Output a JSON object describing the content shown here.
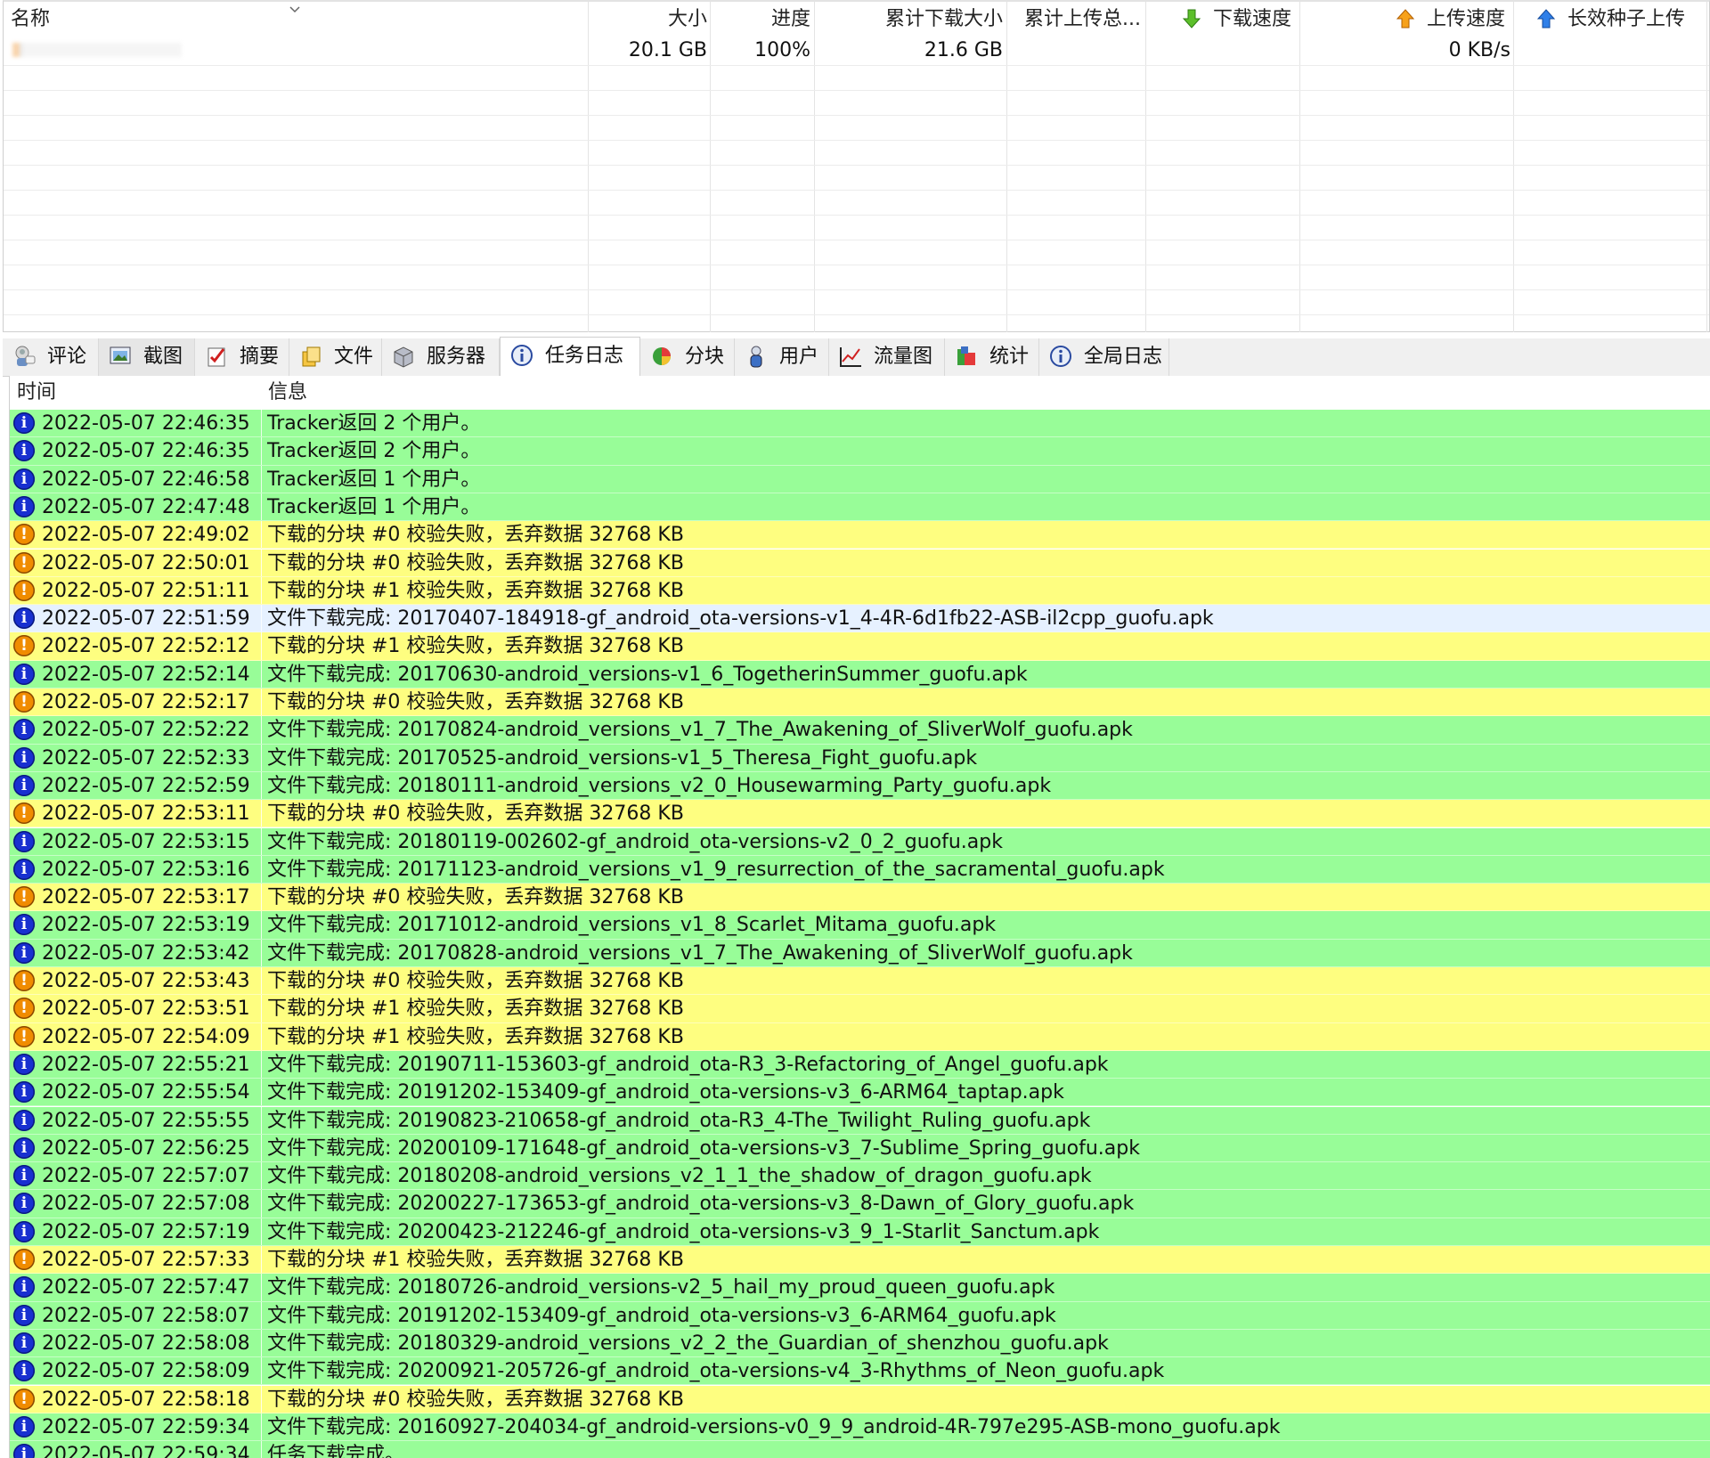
{
  "task_list": {
    "columns": {
      "name": "名称",
      "size": "大小",
      "progress": "进度",
      "downloaded_total": "累计下载大小",
      "uploaded_total": "累计上传总...",
      "download_speed": "下载速度",
      "upload_speed": "上传速度",
      "seed_upload": "长效种子上传"
    },
    "row": {
      "size": "20.1 GB",
      "progress": "100%",
      "downloaded_total": "21.6 GB",
      "upload_speed": "0 KB/s"
    }
  },
  "tabs": [
    {
      "label": "评论",
      "icon": "comment-icon"
    },
    {
      "label": "截图",
      "icon": "screenshot-icon"
    },
    {
      "label": "摘要",
      "icon": "summary-icon"
    },
    {
      "label": "文件",
      "icon": "files-icon"
    },
    {
      "label": "服务器",
      "icon": "server-icon"
    },
    {
      "label": "任务日志",
      "icon": "info-icon",
      "active": true
    },
    {
      "label": "分块",
      "icon": "pie-chart-icon"
    },
    {
      "label": "用户",
      "icon": "user-icon"
    },
    {
      "label": "流量图",
      "icon": "line-chart-icon"
    },
    {
      "label": "统计",
      "icon": "statistics-icon"
    },
    {
      "label": "全局日志",
      "icon": "info-icon"
    }
  ],
  "log": {
    "columns": {
      "time": "时间",
      "message": "信息"
    },
    "colors": {
      "info": "#98fd98",
      "warn": "#fefe80",
      "selected": "#e6f1ff"
    },
    "rows": [
      {
        "type": "info",
        "time": "2022-05-07 22:46:35",
        "message": "Tracker返回 2 个用户。"
      },
      {
        "type": "info",
        "time": "2022-05-07 22:46:35",
        "message": "Tracker返回 2 个用户。"
      },
      {
        "type": "info",
        "time": "2022-05-07 22:46:58",
        "message": "Tracker返回 1 个用户。"
      },
      {
        "type": "info",
        "time": "2022-05-07 22:47:48",
        "message": "Tracker返回 1 个用户。"
      },
      {
        "type": "warn",
        "time": "2022-05-07 22:49:02",
        "message": "下载的分块 #0 校验失败，丢弃数据 32768 KB"
      },
      {
        "type": "warn",
        "time": "2022-05-07 22:50:01",
        "message": "下载的分块 #0 校验失败，丢弃数据 32768 KB"
      },
      {
        "type": "warn",
        "time": "2022-05-07 22:51:11",
        "message": "下载的分块 #1 校验失败，丢弃数据 32768 KB"
      },
      {
        "type": "info",
        "selected": true,
        "time": "2022-05-07 22:51:59",
        "message": "文件下载完成: 20170407-184918-gf_android_ota-versions-v1_4-4R-6d1fb22-ASB-il2cpp_guofu.apk"
      },
      {
        "type": "warn",
        "time": "2022-05-07 22:52:12",
        "message": "下载的分块 #1 校验失败，丢弃数据 32768 KB"
      },
      {
        "type": "info",
        "time": "2022-05-07 22:52:14",
        "message": "文件下载完成: 20170630-android_versions-v1_6_TogetherinSummer_guofu.apk"
      },
      {
        "type": "warn",
        "time": "2022-05-07 22:52:17",
        "message": "下载的分块 #0 校验失败，丢弃数据 32768 KB"
      },
      {
        "type": "info",
        "time": "2022-05-07 22:52:22",
        "message": "文件下载完成: 20170824-android_versions_v1_7_The_Awakening_of_SliverWolf_guofu.apk"
      },
      {
        "type": "info",
        "time": "2022-05-07 22:52:33",
        "message": "文件下载完成: 20170525-android_versions-v1_5_Theresa_Fight_guofu.apk"
      },
      {
        "type": "info",
        "time": "2022-05-07 22:52:59",
        "message": "文件下载完成: 20180111-android_versions_v2_0_Housewarming_Party_guofu.apk"
      },
      {
        "type": "warn",
        "time": "2022-05-07 22:53:11",
        "message": "下载的分块 #0 校验失败，丢弃数据 32768 KB"
      },
      {
        "type": "info",
        "time": "2022-05-07 22:53:15",
        "message": "文件下载完成: 20180119-002602-gf_android_ota-versions-v2_0_2_guofu.apk"
      },
      {
        "type": "info",
        "time": "2022-05-07 22:53:16",
        "message": "文件下载完成: 20171123-android_versions_v1_9_resurrection_of_the_sacramental_guofu.apk"
      },
      {
        "type": "warn",
        "time": "2022-05-07 22:53:17",
        "message": "下载的分块 #0 校验失败，丢弃数据 32768 KB"
      },
      {
        "type": "info",
        "time": "2022-05-07 22:53:19",
        "message": "文件下载完成: 20171012-android_versions_v1_8_Scarlet_Mitama_guofu.apk"
      },
      {
        "type": "info",
        "time": "2022-05-07 22:53:42",
        "message": "文件下载完成: 20170828-android_versions_v1_7_The_Awakening_of_SliverWolf_guofu.apk"
      },
      {
        "type": "warn",
        "time": "2022-05-07 22:53:43",
        "message": "下载的分块 #0 校验失败，丢弃数据 32768 KB"
      },
      {
        "type": "warn",
        "time": "2022-05-07 22:53:51",
        "message": "下载的分块 #1 校验失败，丢弃数据 32768 KB"
      },
      {
        "type": "warn",
        "time": "2022-05-07 22:54:09",
        "message": "下载的分块 #1 校验失败，丢弃数据 32768 KB"
      },
      {
        "type": "info",
        "time": "2022-05-07 22:55:21",
        "message": "文件下载完成: 20190711-153603-gf_android_ota-R3_3-Refactoring_of_Angel_guofu.apk"
      },
      {
        "type": "info",
        "time": "2022-05-07 22:55:54",
        "message": "文件下载完成: 20191202-153409-gf_android_ota-versions-v3_6-ARM64_taptap.apk"
      },
      {
        "type": "info",
        "time": "2022-05-07 22:55:55",
        "message": "文件下载完成: 20190823-210658-gf_android_ota-R3_4-The_Twilight_Ruling_guofu.apk"
      },
      {
        "type": "info",
        "time": "2022-05-07 22:56:25",
        "message": "文件下载完成: 20200109-171648-gf_android_ota-versions-v3_7-Sublime_Spring_guofu.apk"
      },
      {
        "type": "info",
        "time": "2022-05-07 22:57:07",
        "message": "文件下载完成: 20180208-android_versions_v2_1_1_the_shadow_of_dragon_guofu.apk"
      },
      {
        "type": "info",
        "time": "2022-05-07 22:57:08",
        "message": "文件下载完成: 20200227-173653-gf_android_ota-versions-v3_8-Dawn_of_Glory_guofu.apk"
      },
      {
        "type": "info",
        "time": "2022-05-07 22:57:19",
        "message": "文件下载完成: 20200423-212246-gf_android_ota-versions-v3_9_1-Starlit_Sanctum.apk"
      },
      {
        "type": "warn",
        "time": "2022-05-07 22:57:33",
        "message": "下载的分块 #1 校验失败，丢弃数据 32768 KB"
      },
      {
        "type": "info",
        "time": "2022-05-07 22:57:47",
        "message": "文件下载完成: 20180726-android_versions-v2_5_hail_my_proud_queen_guofu.apk"
      },
      {
        "type": "info",
        "time": "2022-05-07 22:58:07",
        "message": "文件下载完成: 20191202-153409-gf_android_ota-versions-v3_6-ARM64_guofu.apk"
      },
      {
        "type": "info",
        "time": "2022-05-07 22:58:08",
        "message": "文件下载完成: 20180329-android_versions_v2_2_the_Guardian_of_shenzhou_guofu.apk"
      },
      {
        "type": "info",
        "time": "2022-05-07 22:58:09",
        "message": "文件下载完成: 20200921-205726-gf_android_ota-versions-v4_3-Rhythms_of_Neon_guofu.apk"
      },
      {
        "type": "warn",
        "time": "2022-05-07 22:58:18",
        "message": "下载的分块 #0 校验失败，丢弃数据 32768 KB"
      },
      {
        "type": "info",
        "time": "2022-05-07 22:59:34",
        "message": "文件下载完成: 20160927-204034-gf_android-versions-v0_9_9_android-4R-797e295-ASB-mono_guofu.apk"
      },
      {
        "type": "info",
        "time": "2022-05-07 22:59:34",
        "message": "任务下载完成。"
      }
    ]
  }
}
